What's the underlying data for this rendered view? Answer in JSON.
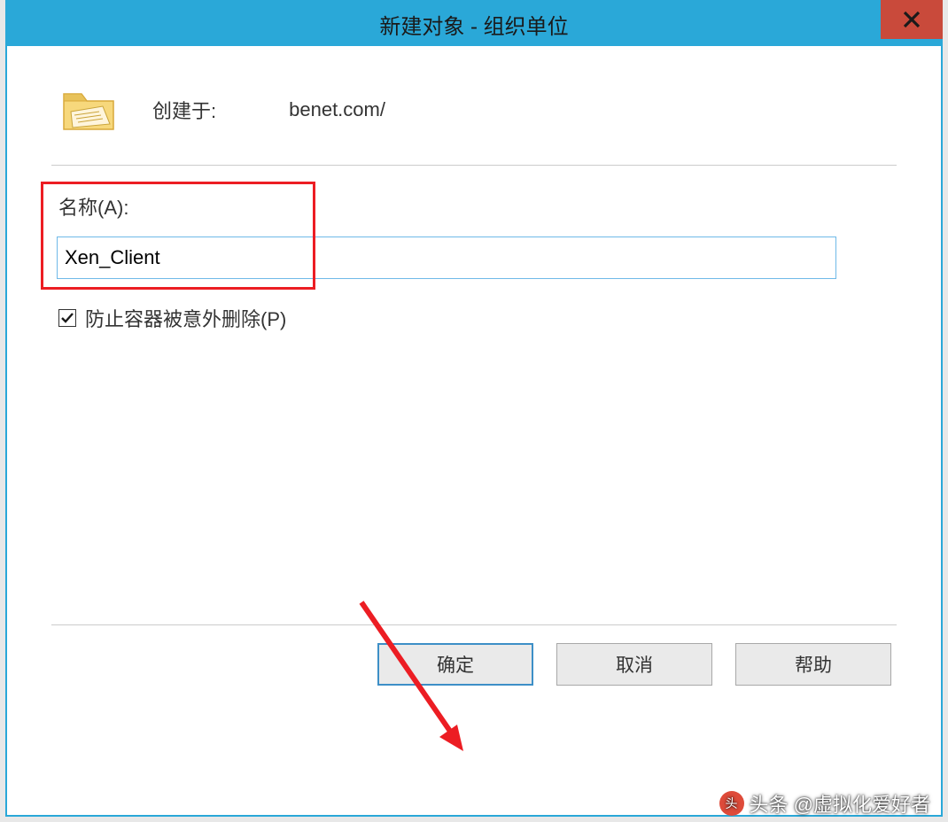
{
  "dialog": {
    "title": "新建对象 - 组织单位",
    "header": {
      "label": "创建于:",
      "path": "benet.com/"
    },
    "name_label": "名称(A):",
    "name_value": "Xen_Client",
    "checkbox": {
      "checked": true,
      "label": "防止容器被意外删除(P)"
    },
    "buttons": {
      "ok": "确定",
      "cancel": "取消",
      "help": "帮助"
    }
  },
  "watermark": "头条 @虚拟化爱好者"
}
